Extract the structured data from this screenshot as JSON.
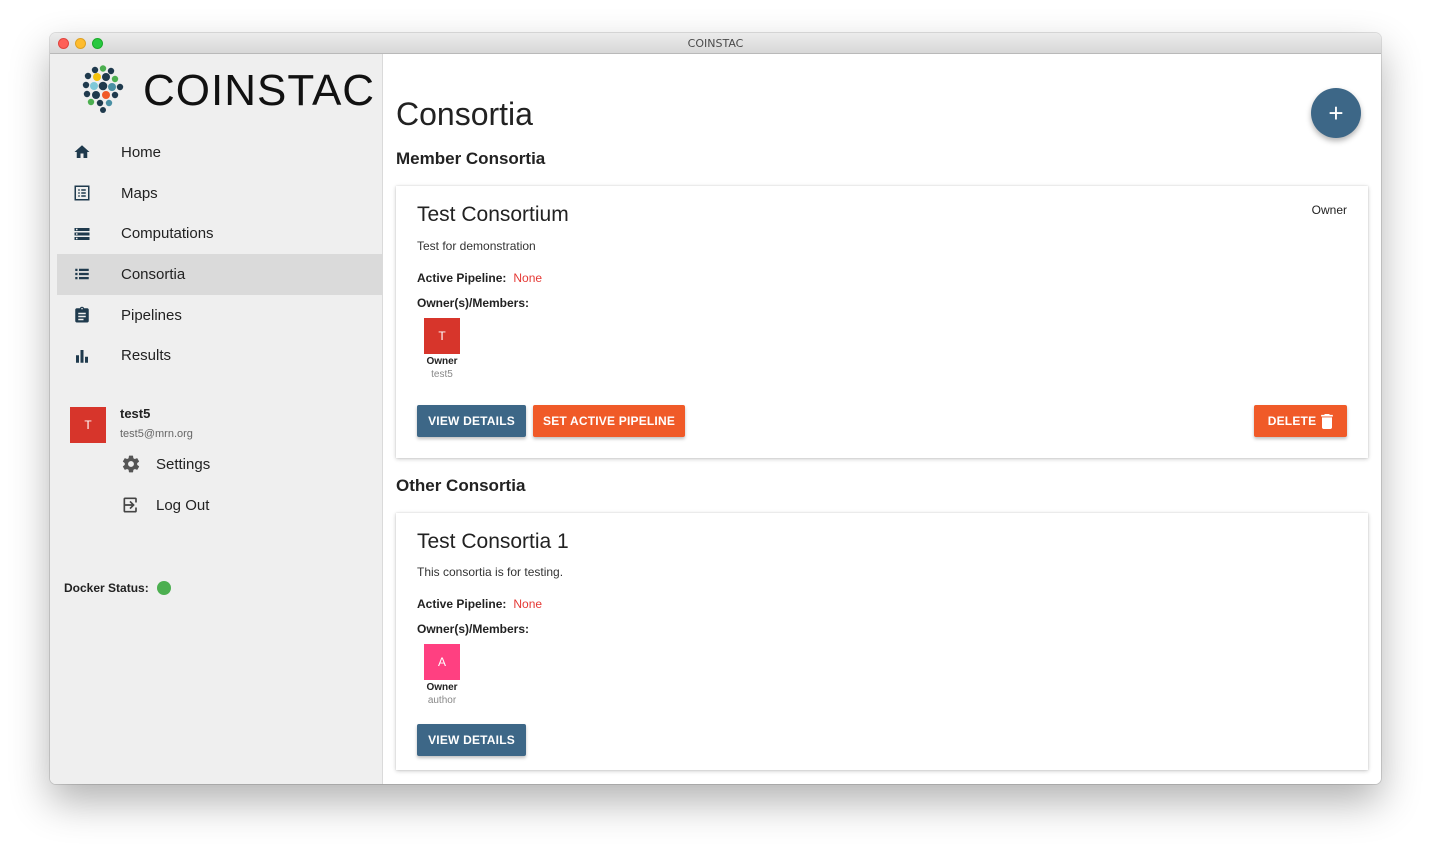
{
  "window": {
    "title": "COINSTAC"
  },
  "app": {
    "name": "COINSTAC"
  },
  "sidebar": {
    "items": [
      {
        "label": "Home",
        "icon": "home-icon",
        "active": false
      },
      {
        "label": "Maps",
        "icon": "maps-icon",
        "active": false
      },
      {
        "label": "Computations",
        "icon": "computations-icon",
        "active": false
      },
      {
        "label": "Consortia",
        "icon": "consortia-icon",
        "active": true
      },
      {
        "label": "Pipelines",
        "icon": "pipelines-icon",
        "active": false
      },
      {
        "label": "Results",
        "icon": "results-icon",
        "active": false
      }
    ],
    "user": {
      "initial": "T",
      "name": "test5",
      "email": "test5@mrn.org",
      "avatar_color": "#d7352b"
    },
    "settings_label": "Settings",
    "logout_label": "Log Out",
    "docker": {
      "label": "Docker Status:",
      "status_color": "#4caf50"
    }
  },
  "main": {
    "title": "Consortia",
    "add_button": "+",
    "member_section": "Member Consortia",
    "other_section": "Other Consortia",
    "member_consortia": [
      {
        "name": "Test Consortium",
        "role": "Owner",
        "description": "Test for demonstration",
        "active_pipeline_label": "Active Pipeline:",
        "active_pipeline_value": "None",
        "members_label": "Owner(s)/Members:",
        "members": [
          {
            "initial": "T",
            "role": "Owner",
            "name": "test5",
            "color": "#d7352b"
          }
        ],
        "view_details": "VIEW DETAILS",
        "set_active_pipeline": "SET ACTIVE PIPELINE",
        "delete": "DELETE"
      }
    ],
    "other_consortia": [
      {
        "name": "Test Consortia 1",
        "description": "This consortia is for testing.",
        "active_pipeline_label": "Active Pipeline:",
        "active_pipeline_value": "None",
        "members_label": "Owner(s)/Members:",
        "members": [
          {
            "initial": "A",
            "role": "Owner",
            "name": "author",
            "color": "#ff4081"
          }
        ],
        "view_details": "VIEW DETAILS"
      }
    ]
  },
  "colors": {
    "primary": "#3d6787",
    "accent": "#f05a28",
    "danger_text": "#e53935"
  }
}
